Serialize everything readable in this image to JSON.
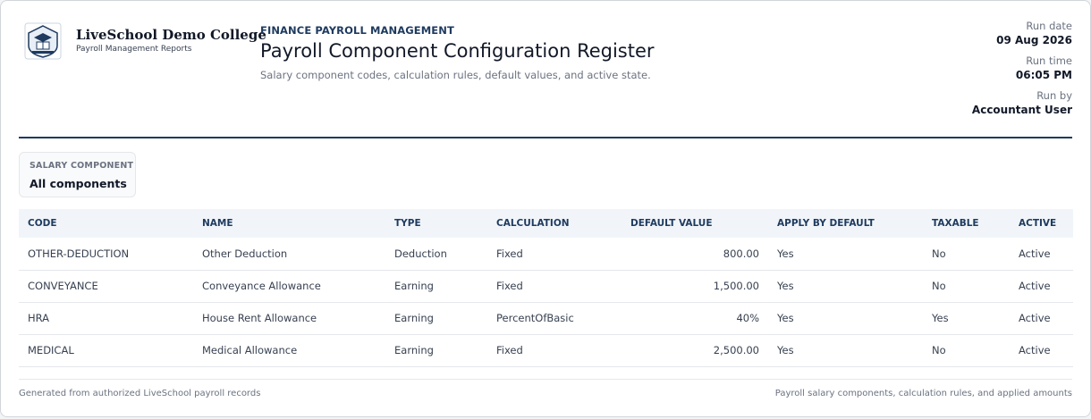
{
  "branding": {
    "logo_icon": "school-crest-icon",
    "college_name": "LiveSchool Demo College",
    "college_subtitle": "Payroll Management Reports"
  },
  "report": {
    "eyebrow": "FINANCE PAYROLL MANAGEMENT",
    "title": "Payroll Component Configuration Register",
    "subtitle": "Salary component codes, calculation rules, default values, and active state."
  },
  "meta": {
    "run_date_label": "Run date",
    "run_date": "09 Aug 2026",
    "run_time_label": "Run time",
    "run_time": "06:05 PM",
    "run_by_label": "Run by",
    "run_by": "Accountant User"
  },
  "filter": {
    "label": "SALARY COMPONENT",
    "value": "All components"
  },
  "table": {
    "headers": [
      "CODE",
      "NAME",
      "TYPE",
      "CALCULATION",
      "DEFAULT VALUE",
      "APPLY BY DEFAULT",
      "TAXABLE",
      "ACTIVE"
    ],
    "rows": [
      [
        "OTHER-DEDUCTION",
        "Other Deduction",
        "Deduction",
        "Fixed",
        "800.00",
        "Yes",
        "No",
        "Active"
      ],
      [
        "CONVEYANCE",
        "Conveyance Allowance",
        "Earning",
        "Fixed",
        "1,500.00",
        "Yes",
        "No",
        "Active"
      ],
      [
        "HRA",
        "House Rent Allowance",
        "Earning",
        "PercentOfBasic",
        "40%",
        "Yes",
        "Yes",
        "Active"
      ],
      [
        "MEDICAL",
        "Medical Allowance",
        "Earning",
        "Fixed",
        "2,500.00",
        "Yes",
        "No",
        "Active"
      ]
    ]
  },
  "footer": {
    "left": "Generated from authorized LiveSchool payroll records",
    "right": "Payroll salary components, calculation rules, and applied amounts"
  },
  "colors": {
    "accent": "#1e3a5f",
    "header_bg": "#f1f5f9"
  }
}
